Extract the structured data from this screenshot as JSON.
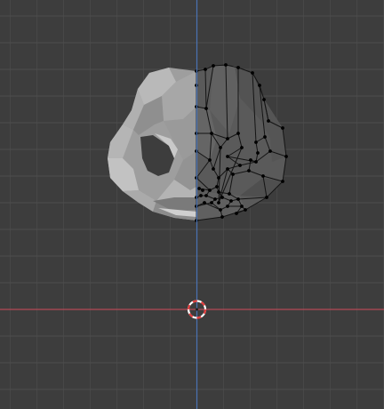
{
  "viewport": {
    "view": "front-orthographic",
    "mode": "edit-mode",
    "background_color": "#3d3d3d",
    "grid_minor_color": "#474747",
    "grid_major_color": "#4d4d4d",
    "axis_x_color": "#b44a55",
    "axis_z_color": "#4a73b4"
  },
  "mesh": {
    "object": "face-mesh",
    "left_half_shading": "solid-gray",
    "right_half_shading": "wireframe-with-vertices",
    "solid_color": "#9a9a9a",
    "edit_face_color": "#5a5a5a",
    "edge_color": "#111111",
    "vertex_color": "#000000"
  },
  "cursor_3d": {
    "icon": "3d-cursor-icon",
    "ring_colors": [
      "#ffffff",
      "#e23b3b"
    ]
  }
}
